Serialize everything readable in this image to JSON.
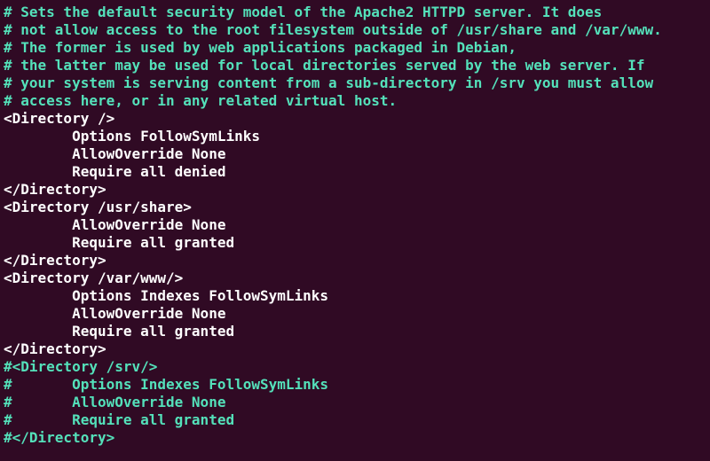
{
  "lines": [
    {
      "cls": "comment",
      "text": "# Sets the default security model of the Apache2 HTTPD server. It does"
    },
    {
      "cls": "comment",
      "text": "# not allow access to the root filesystem outside of /usr/share and /var/www."
    },
    {
      "cls": "comment",
      "text": "# The former is used by web applications packaged in Debian,"
    },
    {
      "cls": "comment",
      "text": "# the latter may be used for local directories served by the web server. If"
    },
    {
      "cls": "comment",
      "text": "# your system is serving content from a sub-directory in /srv you must allow"
    },
    {
      "cls": "comment",
      "text": "# access here, or in any related virtual host."
    },
    {
      "cls": "directive",
      "text": "<Directory />"
    },
    {
      "cls": "directive",
      "text": "        Options FollowSymLinks"
    },
    {
      "cls": "directive",
      "text": "        AllowOverride None"
    },
    {
      "cls": "directive",
      "text": "        Require all denied"
    },
    {
      "cls": "directive",
      "text": "</Directory>"
    },
    {
      "cls": "directive",
      "text": ""
    },
    {
      "cls": "directive",
      "text": "<Directory /usr/share>"
    },
    {
      "cls": "directive",
      "text": "        AllowOverride None"
    },
    {
      "cls": "directive",
      "text": "        Require all granted"
    },
    {
      "cls": "directive",
      "text": "</Directory>"
    },
    {
      "cls": "directive",
      "text": ""
    },
    {
      "cls": "directive",
      "text": "<Directory /var/www/>"
    },
    {
      "cls": "directive",
      "text": "        Options Indexes FollowSymLinks"
    },
    {
      "cls": "directive",
      "text": "        AllowOverride None"
    },
    {
      "cls": "directive",
      "text": "        Require all granted"
    },
    {
      "cls": "directive",
      "text": "</Directory>"
    },
    {
      "cls": "directive",
      "text": ""
    },
    {
      "cls": "comment",
      "text": "#<Directory /srv/>"
    },
    {
      "cls": "comment",
      "text": "#       Options Indexes FollowSymLinks"
    },
    {
      "cls": "comment",
      "text": "#       AllowOverride None"
    },
    {
      "cls": "comment",
      "text": "#       Require all granted"
    },
    {
      "cls": "comment",
      "text": "#</Directory>"
    }
  ]
}
